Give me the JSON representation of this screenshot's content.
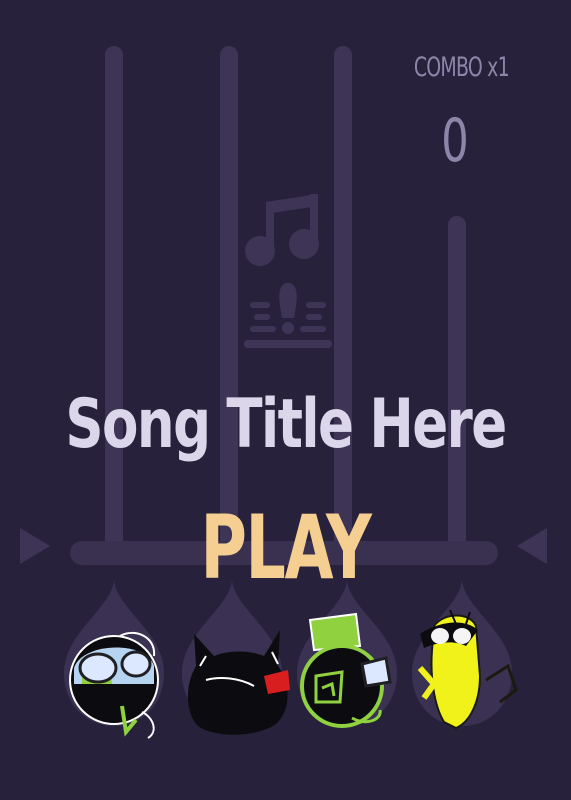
{
  "hud": {
    "combo_label": "COMBO x1",
    "score": "0"
  },
  "song": {
    "title": "Song Title Here",
    "play_label": "PLAY"
  },
  "icons": {
    "center": "music-note-icon",
    "left": "arrow-left-icon",
    "right": "arrow-right-icon"
  },
  "colors": {
    "background": "#28213b",
    "lane": "#3e3556",
    "title": "#dcd6ea",
    "play": "#f5cf92",
    "hud": "#8e86a8",
    "green_accent": "#9ee04a",
    "yellow_accent": "#f0f21a"
  }
}
